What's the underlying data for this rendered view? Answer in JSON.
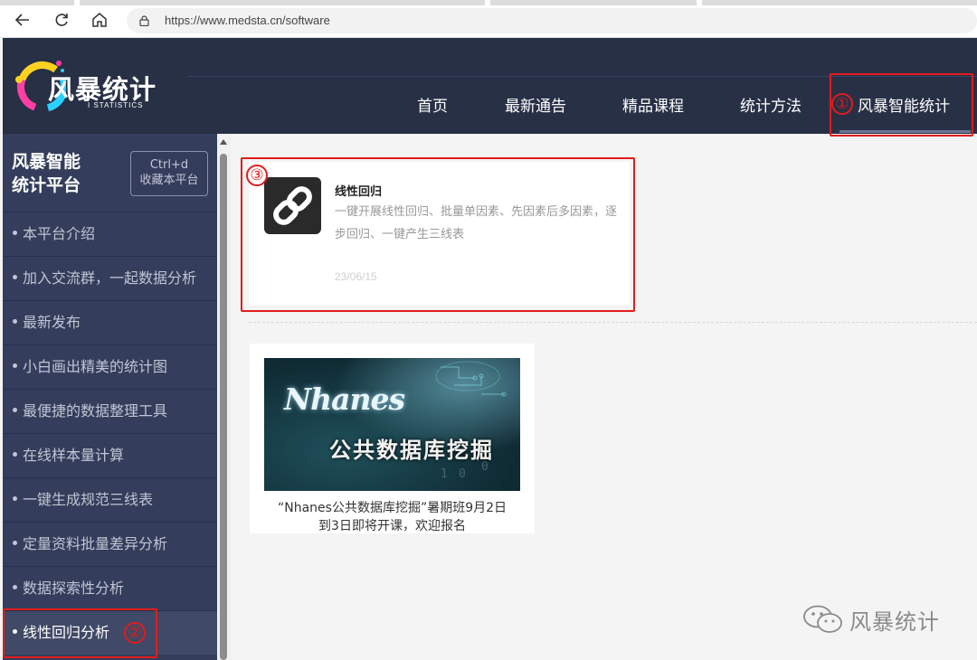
{
  "browser": {
    "url": "https://www.medsta.cn/software",
    "icons": [
      "back-arrow-icon",
      "refresh-icon",
      "home-icon",
      "lock-icon"
    ]
  },
  "header": {
    "logo_text": "风暴统计",
    "logo_sub": "I STATISTICS",
    "nav": [
      {
        "label": "首页"
      },
      {
        "label": "最新通告"
      },
      {
        "label": "精品课程"
      },
      {
        "label": "统计方法"
      },
      {
        "label": "风暴智能统计"
      }
    ],
    "active_nav": "风暴智能统计"
  },
  "sidebar": {
    "title_line1": "风暴智能",
    "title_line2": "统计平台",
    "bookmark_line1": "Ctrl+d",
    "bookmark_line2": "收藏本平台",
    "items": [
      {
        "label": "本平台介绍"
      },
      {
        "label": "加入交流群，一起数据分析"
      },
      {
        "label": "最新发布"
      },
      {
        "label": "小白画出精美的统计图"
      },
      {
        "label": "最便捷的数据整理工具"
      },
      {
        "label": "在线样本量计算"
      },
      {
        "label": "一键生成规范三线表"
      },
      {
        "label": "定量资料批量差异分析"
      },
      {
        "label": "数据探索性分析"
      },
      {
        "label": "线性回归分析"
      }
    ],
    "active_item": "线性回归分析"
  },
  "content": {
    "article": {
      "icon": "link-icon",
      "title": "线性回归",
      "description": "一键开展线性回归、批量单因素、先因素后多因素，逐步回归、一键产生三线表",
      "date": "23/06/15"
    },
    "promo": {
      "image_text1": "Nhanes",
      "image_text2": "公共数据库挖掘",
      "caption_line1": "“Nhanes公共数据库挖掘”暑期班9月2日",
      "caption_line2": "到3日即将开课，欢迎报名"
    }
  },
  "annotations": [
    "①",
    "②",
    "③"
  ],
  "watermark": {
    "icon": "wechat-icon",
    "text": "风暴统计"
  },
  "colors": {
    "header_bg": "#283046",
    "sidebar_bg": "#343d5b",
    "annotation_red": "#e31b1b"
  }
}
